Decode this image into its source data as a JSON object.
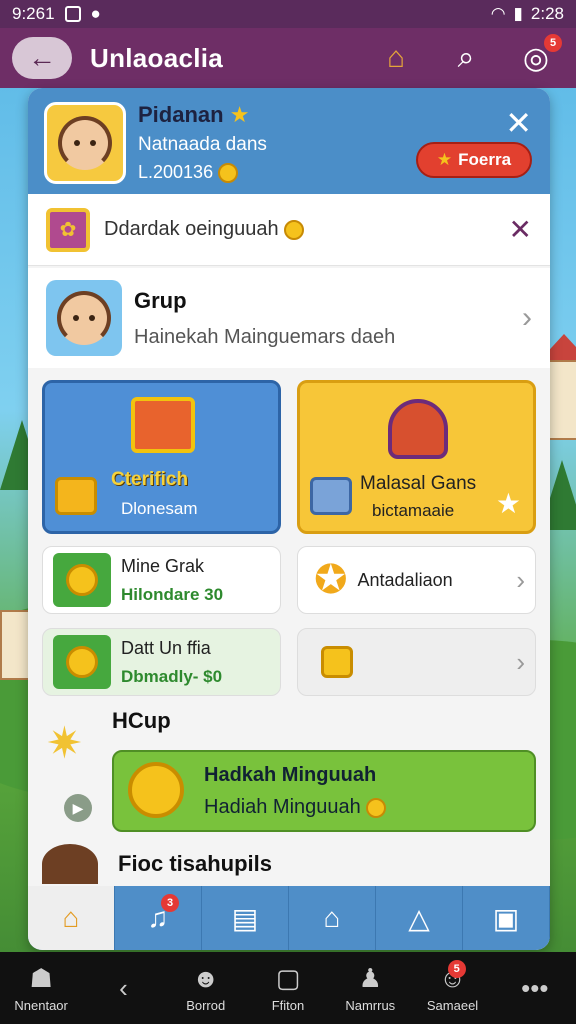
{
  "status_bar": {
    "time": "9:261",
    "clock": "2:28"
  },
  "header": {
    "title": "Unlaoaclia",
    "back_icon": "arrow-left-icon",
    "badge_count": "5"
  },
  "profile": {
    "name": "Pidanan",
    "subtitle": "Natnaada dans",
    "coins": "L.200136",
    "button_label": "Foerra"
  },
  "notice": {
    "text": "Ddardak oeinguuah"
  },
  "group": {
    "title": "Grup",
    "subtitle": "Hainekah Mainguemars daeh"
  },
  "tiles": [
    {
      "title": "Cterifich",
      "subtitle": "Dlonesam"
    },
    {
      "title": "Malasal Gans",
      "subtitle": "bictamaaie"
    }
  ],
  "cards_row1": [
    {
      "title": "Mine Grak",
      "value": "Hilondare 30"
    },
    {
      "title": "Antadaliaon"
    }
  ],
  "cards_row2": [
    {
      "title": "Datt Un ffia",
      "value": "Dbmadly- $0"
    },
    {
      "title": ""
    }
  ],
  "hcup": {
    "title": "HCup",
    "banner_line1": "Hadkah Minguuah",
    "banner_line2": "Hadiah Minguuah"
  },
  "last_item": {
    "title": "Fioc tisahupils"
  },
  "tabbar": {
    "tab2_badge": "3"
  },
  "bottom_nav": [
    {
      "label": "Nnentaor"
    },
    {
      "label": ""
    },
    {
      "label": "Borrod"
    },
    {
      "label": "Ffiton"
    },
    {
      "label": "Namrrus"
    },
    {
      "label": "Samaeel",
      "badge": "5"
    },
    {
      "label": ""
    }
  ],
  "colors": {
    "header": "#6e2e66",
    "panel_header": "#4b8ec8",
    "accent_green": "#79c23c",
    "accent_red": "#e2402f"
  }
}
